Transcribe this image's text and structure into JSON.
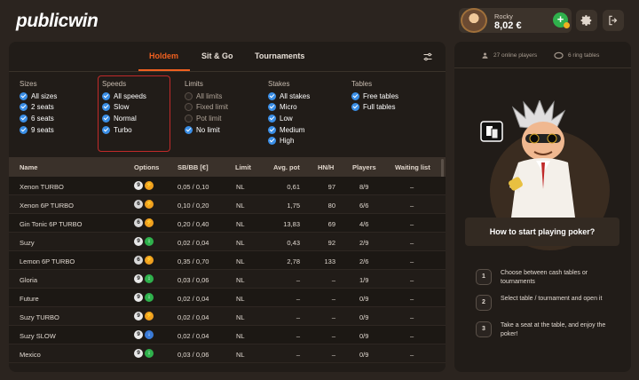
{
  "brand": {
    "logo": "publicwin"
  },
  "user": {
    "name": "Rocky",
    "balance": "8,02 €",
    "add_label": "+"
  },
  "tabs": [
    {
      "label": "Holdem",
      "active": true
    },
    {
      "label": "Sit & Go",
      "active": false
    },
    {
      "label": "Tournaments",
      "active": false
    }
  ],
  "filters": {
    "sizes": {
      "title": "Sizes",
      "options": [
        {
          "label": "All sizes",
          "checked": true
        },
        {
          "label": "2 seats",
          "checked": true
        },
        {
          "label": "6 seats",
          "checked": true
        },
        {
          "label": "9 seats",
          "checked": true
        }
      ]
    },
    "speeds": {
      "title": "Speeds",
      "options": [
        {
          "label": "All speeds",
          "checked": true
        },
        {
          "label": "Slow",
          "checked": true
        },
        {
          "label": "Normal",
          "checked": true
        },
        {
          "label": "Turbo",
          "checked": true
        }
      ]
    },
    "limits": {
      "title": "Limits",
      "options": [
        {
          "label": "All limits",
          "checked": false
        },
        {
          "label": "Fixed limit",
          "checked": false
        },
        {
          "label": "Pot limit",
          "checked": false
        },
        {
          "label": "No limit",
          "checked": true
        }
      ]
    },
    "stakes": {
      "title": "Stakes",
      "options": [
        {
          "label": "All stakes",
          "checked": true
        },
        {
          "label": "Micro",
          "checked": true
        },
        {
          "label": "Low",
          "checked": true
        },
        {
          "label": "Medium",
          "checked": true
        },
        {
          "label": "High",
          "checked": true
        }
      ]
    },
    "tables": {
      "title": "Tables",
      "options": [
        {
          "label": "Free tables",
          "checked": true
        },
        {
          "label": "Full tables",
          "checked": true
        }
      ]
    }
  },
  "table": {
    "columns": [
      "Name",
      "Options",
      "SB/BB [€]",
      "Limit",
      "Avg. pot",
      "HN/H",
      "Players",
      "Waiting list"
    ],
    "rows": [
      {
        "name": "Xenon TURBO",
        "seats": "9",
        "speed": "turbo",
        "stakes": "0,05 / 0,10",
        "limit": "NL",
        "avgpot": "0,61",
        "hnh": "97",
        "players": "8/9",
        "waiting": "–"
      },
      {
        "name": "Xenon 6P TURBO",
        "seats": "6",
        "speed": "turbo",
        "stakes": "0,10 / 0,20",
        "limit": "NL",
        "avgpot": "1,75",
        "hnh": "80",
        "players": "6/6",
        "waiting": "–"
      },
      {
        "name": "Gin Tonic 6P TURBO",
        "seats": "6",
        "speed": "turbo",
        "stakes": "0,20 / 0,40",
        "limit": "NL",
        "avgpot": "13,83",
        "hnh": "69",
        "players": "4/6",
        "waiting": "–"
      },
      {
        "name": "Suzy",
        "seats": "9",
        "speed": "normal",
        "stakes": "0,02 / 0,04",
        "limit": "NL",
        "avgpot": "0,43",
        "hnh": "92",
        "players": "2/9",
        "waiting": "–"
      },
      {
        "name": "Lemon 6P TURBO",
        "seats": "6",
        "speed": "turbo",
        "stakes": "0,35 / 0,70",
        "limit": "NL",
        "avgpot": "2,78",
        "hnh": "133",
        "players": "2/6",
        "waiting": "–"
      },
      {
        "name": "Gloria",
        "seats": "9",
        "speed": "normal",
        "stakes": "0,03 / 0,06",
        "limit": "NL",
        "avgpot": "–",
        "hnh": "–",
        "players": "1/9",
        "waiting": "–"
      },
      {
        "name": "Future",
        "seats": "9",
        "speed": "normal",
        "stakes": "0,02 / 0,04",
        "limit": "NL",
        "avgpot": "–",
        "hnh": "–",
        "players": "0/9",
        "waiting": "–"
      },
      {
        "name": "Suzy TURBO",
        "seats": "9",
        "speed": "turbo",
        "stakes": "0,02 / 0,04",
        "limit": "NL",
        "avgpot": "–",
        "hnh": "–",
        "players": "0/9",
        "waiting": "–"
      },
      {
        "name": "Suzy SLOW",
        "seats": "9",
        "speed": "slow",
        "stakes": "0,02 / 0,04",
        "limit": "NL",
        "avgpot": "–",
        "hnh": "–",
        "players": "0/9",
        "waiting": "–"
      },
      {
        "name": "Mexico",
        "seats": "9",
        "speed": "normal",
        "stakes": "0,03 / 0,06",
        "limit": "NL",
        "avgpot": "–",
        "hnh": "–",
        "players": "0/9",
        "waiting": "–"
      }
    ]
  },
  "sidebar": {
    "online_players": "27 online players",
    "ring_tables": "6 ring tables",
    "howto_title": "How to start playing poker?",
    "steps": [
      {
        "n": "1",
        "text": "Choose between cash tables or tournaments"
      },
      {
        "n": "2",
        "text": "Select table / tournament and open it"
      },
      {
        "n": "3",
        "text": "Take a seat at the table, and enjoy the poker!"
      }
    ]
  },
  "colors": {
    "accent": "#f06020",
    "checkbox": "#3a8ee6",
    "speed_turbo": "#f0a020",
    "speed_normal": "#2fb14c",
    "speed_slow": "#3a7ad6"
  }
}
